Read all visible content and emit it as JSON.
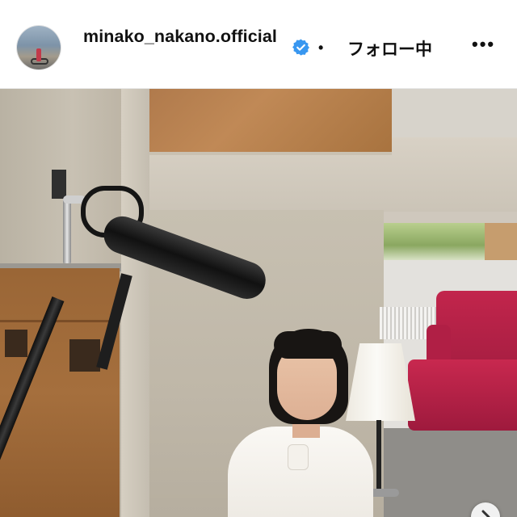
{
  "post_header": {
    "username": "minako_nakano.official",
    "verified": true,
    "separator": "•",
    "follow_label": "フォロー中",
    "more_label": "•••",
    "verified_color": "#3897f0"
  },
  "media": {
    "carousel_next_icon": "chevron-right-icon"
  }
}
